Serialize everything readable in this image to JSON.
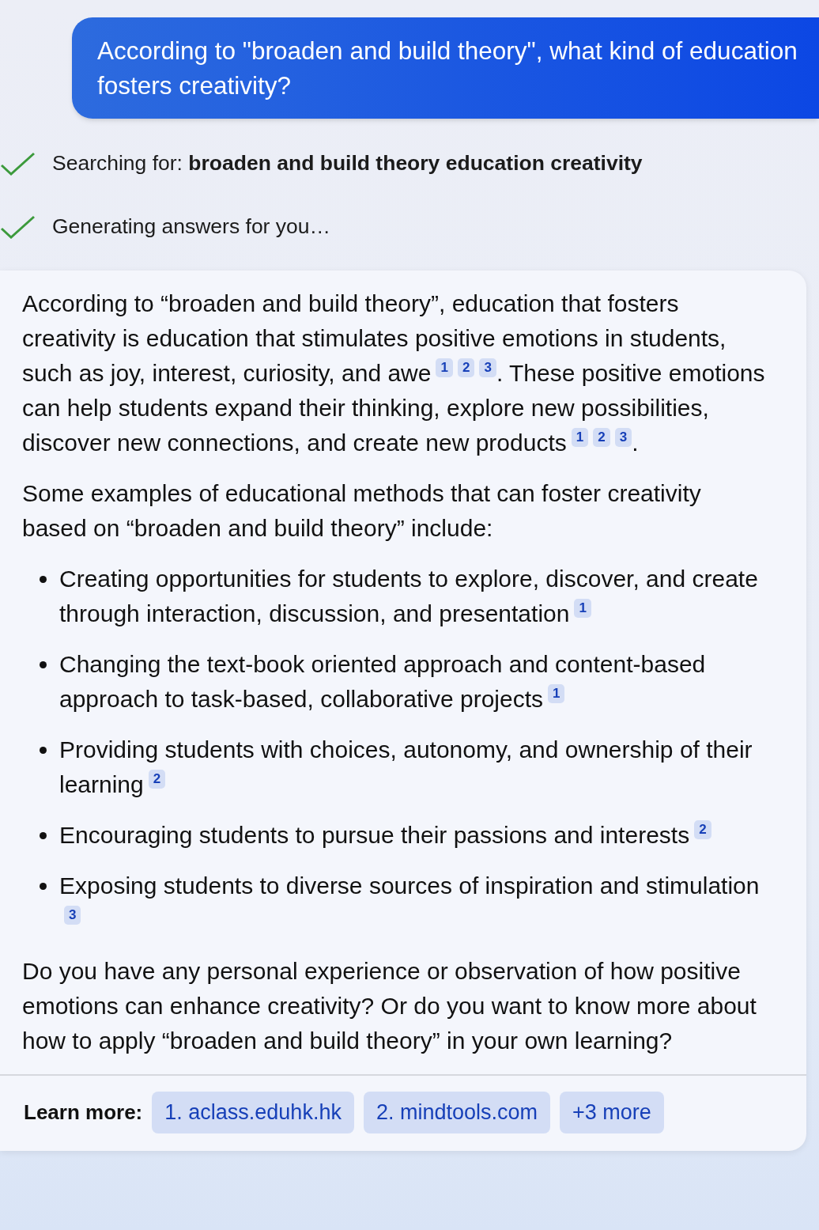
{
  "question": "According to \"broaden and build theory\", what kind of education fosters creativity?",
  "steps": [
    {
      "text": "Searching for: **broaden and build theory education creativity**",
      "done": true
    },
    {
      "text": "Generating answers for you…",
      "done": true
    }
  ],
  "answer": {
    "blocks": [
      {
        "kind": "paragraph",
        "parts": [
          {
            "kind": "text",
            "text": "According to “broaden and build theory”, education that fosters creativity is education that stimulates positive emotions in students, such as joy, interest, curiosity, and awe"
          },
          {
            "kind": "cite",
            "text": "1"
          },
          {
            "kind": "cite",
            "text": "2"
          },
          {
            "kind": "cite",
            "text": "3"
          },
          {
            "kind": "text",
            "text": ". These positive emotions can help students expand their thinking, explore new possibilities, discover new connections, and create new products"
          },
          {
            "kind": "cite",
            "text": "1"
          },
          {
            "kind": "cite",
            "text": "2"
          },
          {
            "kind": "cite",
            "text": "3"
          },
          {
            "kind": "text",
            "text": "."
          }
        ]
      },
      {
        "kind": "paragraph",
        "parts": [
          {
            "kind": "text",
            "text": "Some examples of educational methods that can foster creativity based on “broaden and build theory” include:"
          }
        ]
      },
      {
        "kind": "list",
        "items": [
          {
            "parts": [
              {
                "kind": "text",
                "text": "Creating opportunities for students to explore, discover, and create through interaction, discussion, and presentation"
              },
              {
                "kind": "cite",
                "text": "1"
              }
            ]
          },
          {
            "parts": [
              {
                "kind": "text",
                "text": "Changing the text-book oriented approach and content-based approach to task-based, collaborative projects"
              },
              {
                "kind": "cite",
                "text": "1"
              }
            ]
          },
          {
            "parts": [
              {
                "kind": "text",
                "text": "Providing students with choices, autonomy, and ownership of their learning"
              },
              {
                "kind": "cite",
                "text": "2"
              }
            ]
          },
          {
            "parts": [
              {
                "kind": "text",
                "text": "Encouraging students to pursue their passions and interests"
              },
              {
                "kind": "cite",
                "text": "2"
              }
            ]
          },
          {
            "parts": [
              {
                "kind": "text",
                "text": "Exposing students to diverse sources of inspiration and stimulation"
              },
              {
                "kind": "cite",
                "text": "3"
              }
            ]
          }
        ]
      },
      {
        "kind": "paragraph",
        "parts": [
          {
            "kind": "text",
            "text": "Do you have any personal experience or observation of how positive emotions can enhance creativity? Or do you want to know more about how to apply “broaden and build theory” in your own learning?"
          }
        ]
      }
    ],
    "learn_more": {
      "label": "Learn more:",
      "links": [
        "1. aclass.eduhk.hk",
        "2. mindtools.com",
        "+3 more"
      ]
    }
  }
}
